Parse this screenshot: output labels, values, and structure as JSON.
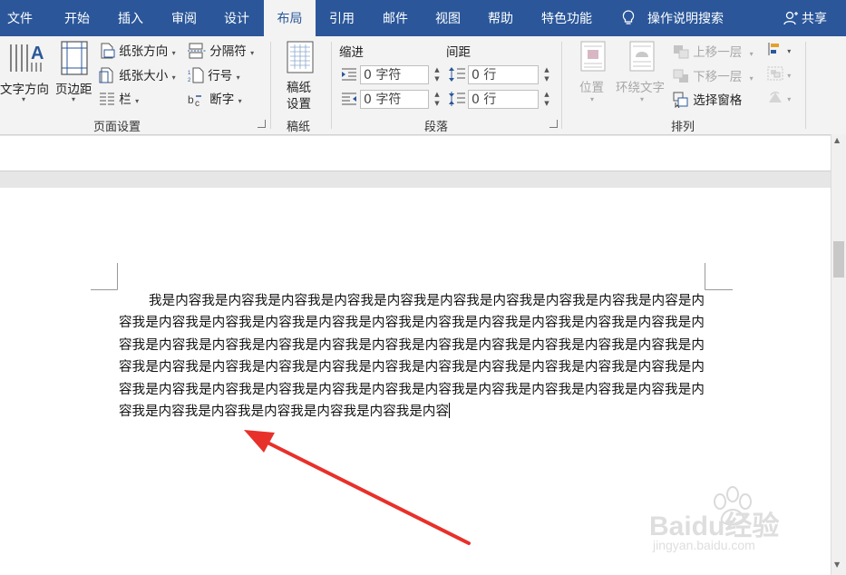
{
  "tabs": {
    "file": "文件",
    "home": "开始",
    "insert": "插入",
    "review": "审阅",
    "design": "设计",
    "layout": "布局",
    "references": "引用",
    "mailings": "邮件",
    "view": "视图",
    "help": "帮助",
    "special": "特色功能",
    "tell_me": "操作说明搜索",
    "share": "共享"
  },
  "page_setup": {
    "text_direction": "文字方向",
    "margins": "页边距",
    "orientation": "纸张方向",
    "size": "纸张大小",
    "columns": "栏",
    "breaks": "分隔符",
    "line_numbers": "行号",
    "hyphenation": "断字",
    "group_label": "页面设置"
  },
  "manuscript": {
    "label_line1": "稿纸",
    "label_line2": "设置",
    "group_label": "稿纸"
  },
  "paragraph": {
    "indent_header": "缩进",
    "spacing_header": "间距",
    "indent_left": "0 字符",
    "indent_right": "0 字符",
    "spacing_before": "0 行",
    "spacing_after": "0 行",
    "group_label": "段落"
  },
  "arrange": {
    "position": "位置",
    "wrap_text": "环绕文字",
    "bring_forward": "上移一层",
    "send_backward": "下移一层",
    "selection_pane": "选择窗格",
    "group_label": "排列"
  },
  "document": {
    "lines": [
      "我是内容我是内容我是内容我是内容我是内容我是内容我是内容我是内容我是内容我是内容",
      "是内容我是内容我是内容我是内容我是内容我是内容我是内容我是内容我是内容我是内容",
      "我是内容我是内容我是内容我是内容我是内容我是内容我是内容我是内容我是内容我是内",
      "容我是内容我是内容我是内容我是内容我是内容我是内容我是内容我是内容我是内容我是",
      "内容我是内容我是内容我是内容我是内容我是内容我是内容我是内容我是内容我是内容我",
      "是内容我是内容我是内容我是内容我是内容我是内容我是内容我是内容我是内容我是内容",
      "我是内容我是内容"
    ]
  },
  "watermark": {
    "brand": "Baidu经验",
    "url": "jingyan.baidu.com"
  },
  "colors": {
    "ribbon_blue": "#2b579a",
    "arrow_red": "#e8302a"
  }
}
